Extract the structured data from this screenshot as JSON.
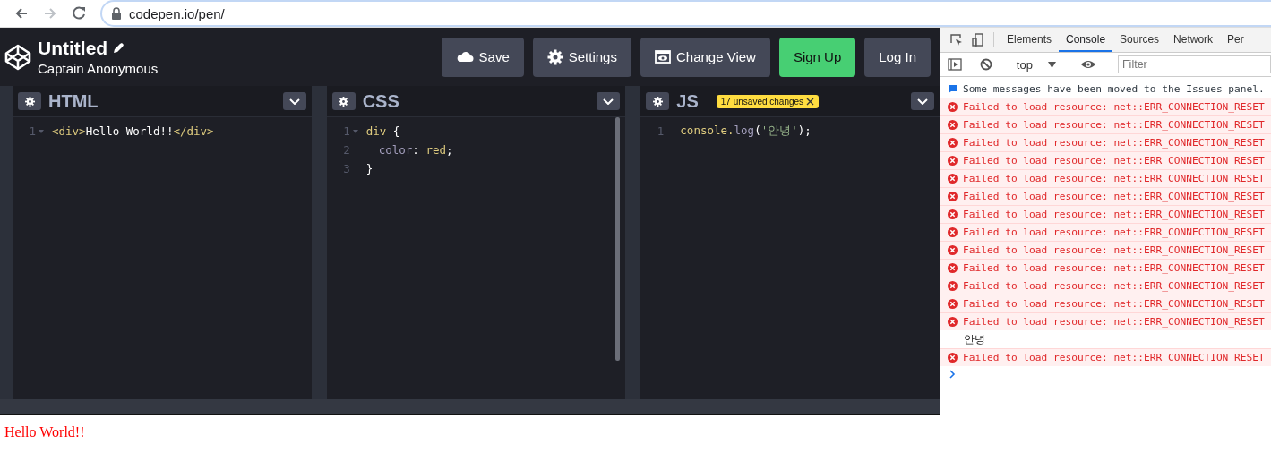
{
  "browser": {
    "url": "codepen.io/pen/",
    "forward_disabled": true
  },
  "pen_header": {
    "title": "Untitled",
    "author": "Captain Anonymous",
    "buttons": [
      {
        "label": "Save",
        "kind": "save"
      },
      {
        "label": "Settings",
        "kind": "settings"
      },
      {
        "label": "Change View",
        "kind": "view"
      },
      {
        "label": "Sign Up",
        "kind": "signup"
      },
      {
        "label": "Log In",
        "kind": "login"
      }
    ]
  },
  "editors": [
    {
      "title": "HTML",
      "scrollbar": false,
      "lines": [
        {
          "number": "1",
          "foldable": true,
          "tokens": [
            {
              "kind": "tag",
              "text": "<div>"
            },
            {
              "kind": "plain",
              "text": "Hello World!!"
            },
            {
              "kind": "tag",
              "text": "</div>"
            }
          ]
        }
      ]
    },
    {
      "title": "CSS",
      "scrollbar": true,
      "lines": [
        {
          "number": "1",
          "foldable": true,
          "tokens": [
            {
              "kind": "tag",
              "text": "div"
            },
            {
              "kind": "plain",
              "text": " {"
            }
          ]
        },
        {
          "number": "2",
          "foldable": false,
          "indented": true,
          "tokens": [
            {
              "kind": "property",
              "text": "color"
            },
            {
              "kind": "plain",
              "text": ": "
            },
            {
              "kind": "tag",
              "text": "red"
            },
            {
              "kind": "plain",
              "text": ";"
            }
          ]
        },
        {
          "number": "3",
          "foldable": false,
          "tokens": [
            {
              "kind": "plain",
              "text": "}"
            }
          ]
        }
      ]
    },
    {
      "title": "JS",
      "badge": "17 unsaved changes",
      "scrollbar": false,
      "lines": [
        {
          "number": "1",
          "foldable": false,
          "tokens": [
            {
              "kind": "tag",
              "text": "console."
            },
            {
              "kind": "property",
              "text": "log"
            },
            {
              "kind": "plain",
              "text": "("
            },
            {
              "kind": "string",
              "text": "'안녕'"
            },
            {
              "kind": "plain",
              "text": ");"
            }
          ]
        }
      ]
    }
  ],
  "preview": {
    "text": "Hello World!!"
  },
  "devtools": {
    "tabs": [
      {
        "label": "Elements",
        "selected": false
      },
      {
        "label": "Console",
        "selected": true
      },
      {
        "label": "Sources",
        "selected": false
      },
      {
        "label": "Network",
        "selected": false
      },
      {
        "label": "Per",
        "selected": false
      }
    ],
    "context": "top",
    "filter": {
      "placeholder": "Filter"
    },
    "messages": [
      {
        "kind": "info",
        "text": "Some messages have been moved to the Issues panel."
      },
      {
        "kind": "error",
        "text": "Failed to load resource: net::ERR_CONNECTION_RESET"
      },
      {
        "kind": "error",
        "text": "Failed to load resource: net::ERR_CONNECTION_RESET"
      },
      {
        "kind": "error",
        "text": "Failed to load resource: net::ERR_CONNECTION_RESET"
      },
      {
        "kind": "error",
        "text": "Failed to load resource: net::ERR_CONNECTION_RESET"
      },
      {
        "kind": "error",
        "text": "Failed to load resource: net::ERR_CONNECTION_RESET"
      },
      {
        "kind": "error",
        "text": "Failed to load resource: net::ERR_CONNECTION_RESET"
      },
      {
        "kind": "error",
        "text": "Failed to load resource: net::ERR_CONNECTION_RESET"
      },
      {
        "kind": "error",
        "text": "Failed to load resource: net::ERR_CONNECTION_RESET"
      },
      {
        "kind": "error",
        "text": "Failed to load resource: net::ERR_CONNECTION_RESET"
      },
      {
        "kind": "error",
        "text": "Failed to load resource: net::ERR_CONNECTION_RESET"
      },
      {
        "kind": "error",
        "text": "Failed to load resource: net::ERR_CONNECTION_RESET"
      },
      {
        "kind": "error",
        "text": "Failed to load resource: net::ERR_CONNECTION_RESET"
      },
      {
        "kind": "error",
        "text": "Failed to load resource: net::ERR_CONNECTION_RESET"
      },
      {
        "kind": "log",
        "text": "안녕"
      },
      {
        "kind": "error",
        "text": "Failed to load resource: net::ERR_CONNECTION_RESET"
      }
    ]
  }
}
